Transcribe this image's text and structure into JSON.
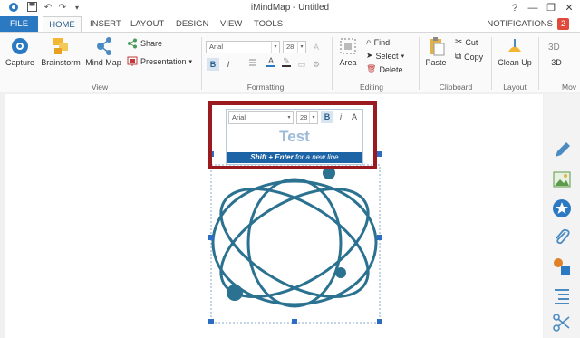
{
  "window": {
    "title": "iMindMap - Untitled"
  },
  "tabs": [
    {
      "label": "FILE"
    },
    {
      "label": "HOME"
    },
    {
      "label": "INSERT"
    },
    {
      "label": "LAYOUT"
    },
    {
      "label": "DESIGN"
    },
    {
      "label": "VIEW"
    },
    {
      "label": "TOOLS"
    }
  ],
  "notifications": {
    "label": "NOTIFICATIONS",
    "count": "2"
  },
  "window_controls": {
    "help": "?",
    "minimize": "—",
    "restore": "❐",
    "close": "✕"
  },
  "ribbon": {
    "view": {
      "capture": "Capture",
      "brainstorm": "Brainstorm",
      "mindmap": "Mind Map",
      "share": "Share",
      "presentation": "Presentation",
      "group": "View"
    },
    "formatting": {
      "font": "Arial",
      "size": "28",
      "group": "Formatting"
    },
    "editing": {
      "area": "Area",
      "find": "Find",
      "select": "Select",
      "delete": "Delete",
      "group": "Editing"
    },
    "clipboard": {
      "paste": "Paste",
      "cut": "Cut",
      "copy": "Copy",
      "group": "Clipboard"
    },
    "layout": {
      "cleanup": "Clean Up",
      "group": "Layout"
    },
    "move": {
      "btn3d": "3D",
      "group": "Mov"
    }
  },
  "editor": {
    "font": "Arial",
    "size": "28",
    "bold": "B",
    "italic": "i",
    "color": "A",
    "text": "Test",
    "hint_keys": "Shift + Enter",
    "hint_rest": "for a new line"
  },
  "colors": {
    "accent": "#2b79c2",
    "highlight": "#9a1a1f",
    "diagram": "#2b7190",
    "hint_bar": "#1d64a6",
    "badge": "#e04a3c"
  },
  "sidebar_icons": [
    "pencil-icon",
    "image-icon",
    "star-icon",
    "paperclip-icon",
    "shapes-icon",
    "list-icon",
    "scissors-icon"
  ]
}
